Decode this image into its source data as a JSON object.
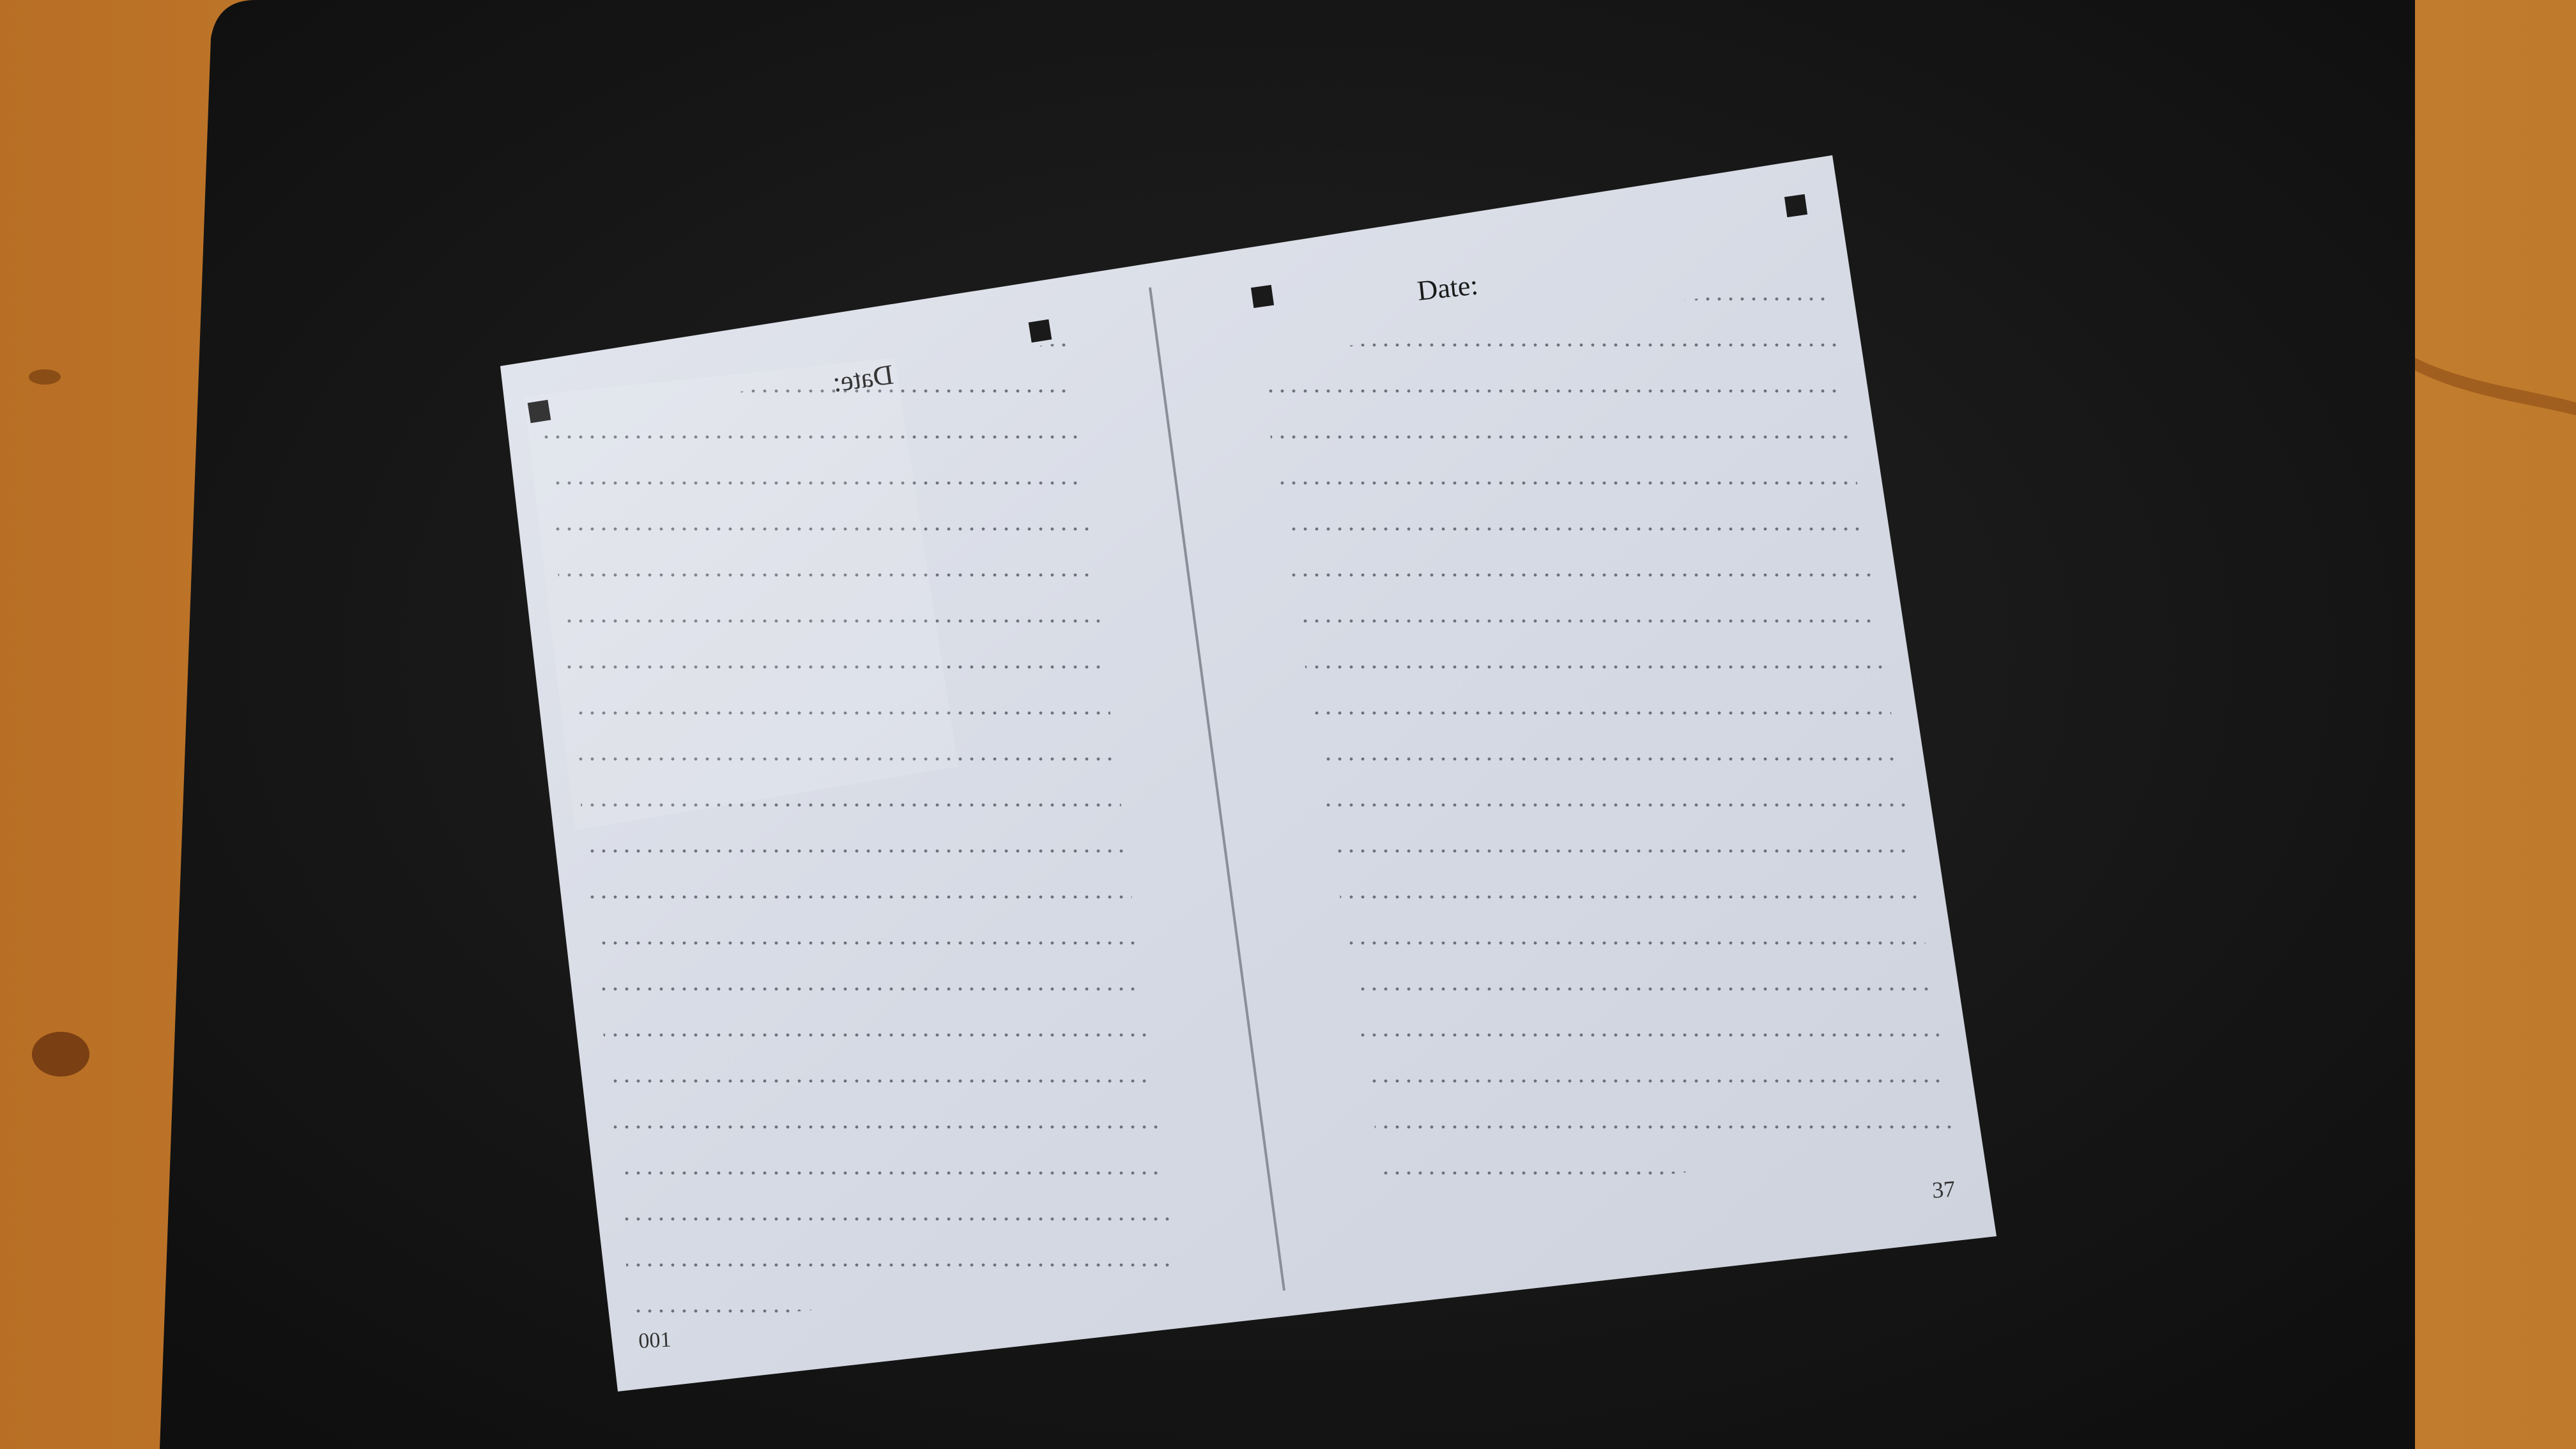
{
  "scene": {
    "description_free": true,
    "colors": {
      "wood": "#c9822f",
      "wood_dark": "#9a5a1e",
      "mat": "#161616",
      "paper": "#d9dde6",
      "ink": "#1a1a1a"
    }
  },
  "sheet": {
    "left_page": {
      "date_label": "Date:",
      "date_label_mirrored": true,
      "page_number": "001"
    },
    "right_page": {
      "date_label": "Date:",
      "page_number": "37"
    }
  }
}
